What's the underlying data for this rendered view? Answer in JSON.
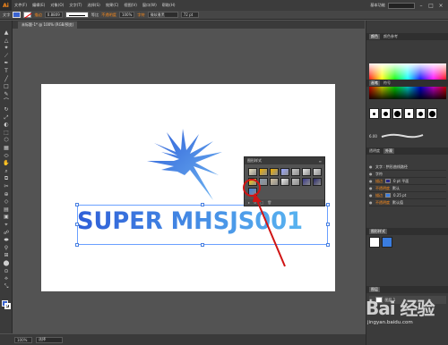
{
  "app": {
    "logo": "Ai",
    "workspace": "基本功能"
  },
  "menu": [
    "文件(F)",
    "编辑(E)",
    "对象(O)",
    "文字(T)",
    "选择(S)",
    "效果(C)",
    "视图(V)",
    "窗口(W)",
    "帮助(H)"
  ],
  "control_bar": {
    "type_label": "文字",
    "stroke_label": "描边",
    "stroke_weight": "0.8809",
    "stroke_style": "等比",
    "opacity_label": "不透明度",
    "opacity_value": "100%",
    "char_label": "字符",
    "font": "微软雅黑",
    "size": "72 pt",
    "fill_color": "#3a63d0"
  },
  "document_tab": "未标题-1* @ 100% (RGB/预览)",
  "artwork": {
    "title_text": "SUPER MHSJS001",
    "text_color_start": "#2f5fd8",
    "text_color_end": "#59b4f0"
  },
  "graphic_styles_panel": {
    "title": "图形样式",
    "swatches": [
      "#e8e0c0",
      "#f0b000",
      "#f0b000",
      "#9aa8ff",
      "#c8c8c8",
      "#e8e8e8",
      "#d8d8d8",
      "#ffcc00",
      "#8899aa",
      "#d0c0a0",
      "#eeeeee",
      "#c0c0c0",
      "#3a3a8a",
      "#2a2a6a",
      "#3a7de0"
    ]
  },
  "right_panels": {
    "color_tabs": [
      "颜色",
      "颜色参考"
    ],
    "brush_tabs": [
      "画笔",
      "符号"
    ],
    "stroke_value": "6.00",
    "appearance_tabs": [
      "透明度",
      "外观"
    ],
    "appearance_rows": [
      {
        "label": "文字 : 拱形曲线路径",
        "orange": false,
        "sw": ""
      },
      {
        "label": "字符",
        "orange": false,
        "sw": ""
      },
      {
        "label": "描边",
        "orange": true,
        "value": "0 pt 平面",
        "sw": "#2a2a8a"
      },
      {
        "label": "不透明度",
        "orange": true,
        "value": "默认",
        "sw": ""
      },
      {
        "label": "描边",
        "orange": true,
        "value": "0.25 pt",
        "sw": "#3a7de0"
      },
      {
        "label": "不透明度",
        "orange": true,
        "value": "默认值",
        "sw": ""
      }
    ],
    "gfx_mini_title": "图形样式",
    "layers_title": "图层",
    "layer_name": "图层 1"
  },
  "status_bar": {
    "zoom": "100%",
    "status": "选择"
  },
  "watermark": {
    "brand": "Bai 经验",
    "url": "jingyan.baidu.com"
  }
}
